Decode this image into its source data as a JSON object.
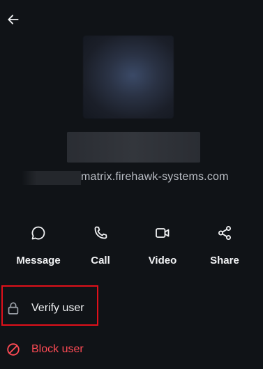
{
  "header": {
    "back_icon": "arrow-left-icon"
  },
  "profile": {
    "avatar": "blurred-avatar",
    "display_name": "",
    "user_id_server": "matrix.firehawk-systems.com"
  },
  "actions": [
    {
      "label": "Message",
      "icon": "chat-bubble-icon"
    },
    {
      "label": "Call",
      "icon": "phone-icon"
    },
    {
      "label": "Video",
      "icon": "video-camera-icon"
    },
    {
      "label": "Share",
      "icon": "share-icon"
    }
  ],
  "menu": {
    "verify": {
      "label": "Verify user",
      "icon": "lock-icon"
    },
    "block": {
      "label": "Block user",
      "icon": "block-icon"
    }
  },
  "colors": {
    "background": "#101317",
    "text_primary": "#f2f3f5",
    "text_secondary": "#b9bdc4",
    "danger": "#ff4b55",
    "highlight_border": "#e0101a"
  }
}
